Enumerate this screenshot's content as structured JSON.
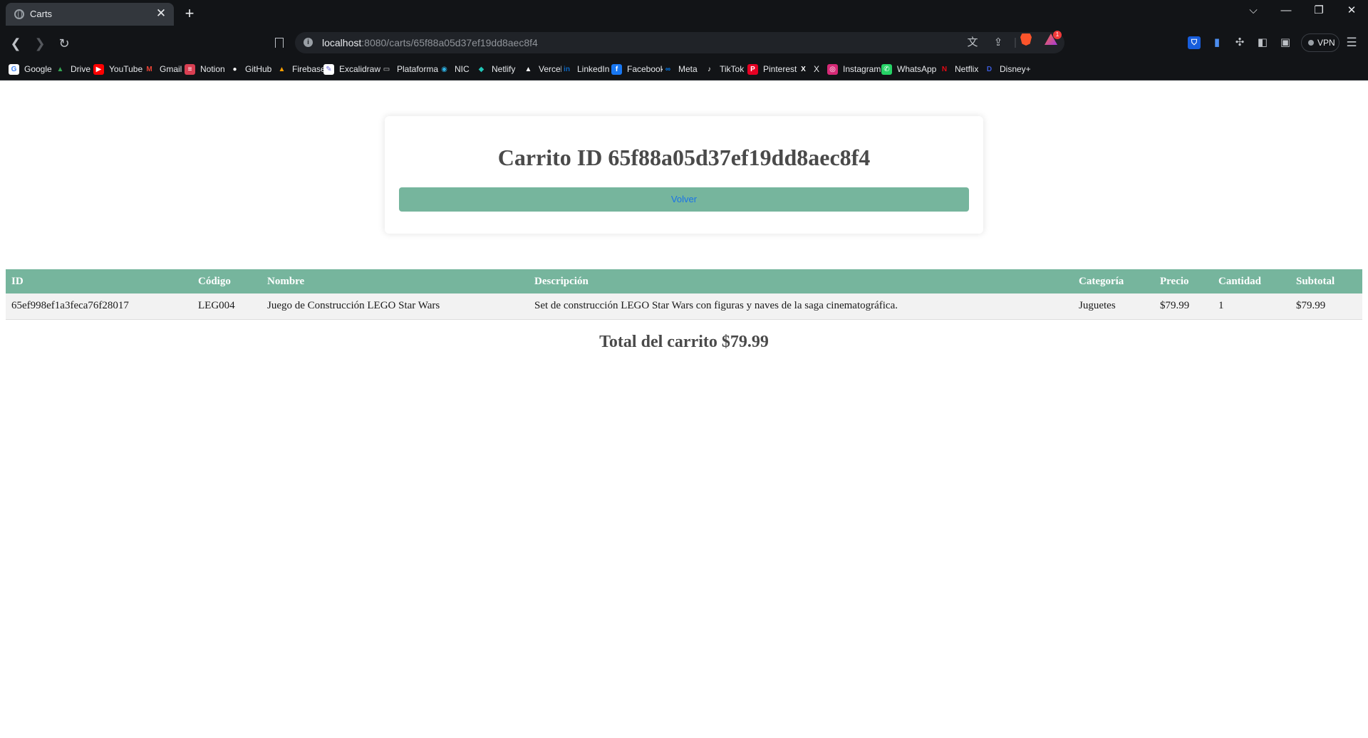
{
  "browser": {
    "tab": {
      "title": "Carts",
      "close": "✕"
    },
    "new_tab": "+",
    "window_controls": {
      "tab_list": "⌵",
      "minimize": "—",
      "restore": "❐",
      "close": "✕"
    },
    "nav": {
      "back": "❮",
      "forward": "❯",
      "reload": "↻"
    },
    "url": {
      "host": "localhost",
      "path": ":8080/carts/65f88a05d37ef19dd8aec8f4"
    },
    "url_icons": {
      "translate": "文",
      "share": "⇪",
      "divider": "|"
    },
    "rewards_count": "1",
    "extensions": {
      "bitwarden": "⛉",
      "extension2": "▮",
      "puzzle": "✣",
      "sidebar": "◧",
      "wallet": "▣"
    },
    "vpn_label": "VPN",
    "menu": "☰"
  },
  "bookmarks": [
    {
      "label": "Google",
      "icon": "google-icon",
      "glyph": "G",
      "color": "#ffffff",
      "fg": "#4285f4"
    },
    {
      "label": "Drive",
      "icon": "drive-icon",
      "glyph": "▲",
      "color": "#121417",
      "fg": "#34a853"
    },
    {
      "label": "YouTube",
      "icon": "youtube-icon",
      "glyph": "▶",
      "color": "#ff0000",
      "fg": "#ffffff"
    },
    {
      "label": "Gmail",
      "icon": "gmail-icon",
      "glyph": "M",
      "color": "#121417",
      "fg": "#ea4335"
    },
    {
      "label": "Notion",
      "icon": "notion-icon",
      "glyph": "≡",
      "color": "#d93f52",
      "fg": "#ffffff"
    },
    {
      "label": "GitHub",
      "icon": "github-icon",
      "glyph": "●",
      "color": "#121417",
      "fg": "#ffffff"
    },
    {
      "label": "Firebase",
      "icon": "firebase-icon",
      "glyph": "▲",
      "color": "#121417",
      "fg": "#ffa000"
    },
    {
      "label": "Excalidraw",
      "icon": "excalidraw-icon",
      "glyph": "✎",
      "color": "#ffffff",
      "fg": "#6965db"
    },
    {
      "label": "Plataforma",
      "icon": "plataforma-icon",
      "glyph": "▭",
      "color": "#121417",
      "fg": "#cccccc"
    },
    {
      "label": "NIC",
      "icon": "nic-icon",
      "glyph": "◉",
      "color": "#121417",
      "fg": "#2eb3e6"
    },
    {
      "label": "Netlify",
      "icon": "netlify-icon",
      "glyph": "◆",
      "color": "#121417",
      "fg": "#20c6b7"
    },
    {
      "label": "Vercel",
      "icon": "vercel-icon",
      "glyph": "▲",
      "color": "#121417",
      "fg": "#ffffff"
    },
    {
      "label": "LinkedIn",
      "icon": "linkedin-icon",
      "glyph": "in",
      "color": "#121417",
      "fg": "#0a66c2"
    },
    {
      "label": "Facebook",
      "icon": "facebook-icon",
      "glyph": "f",
      "color": "#1877f2",
      "fg": "#ffffff"
    },
    {
      "label": "Meta",
      "icon": "meta-icon",
      "glyph": "∞",
      "color": "#121417",
      "fg": "#0081fb"
    },
    {
      "label": "TikTok",
      "icon": "tiktok-icon",
      "glyph": "♪",
      "color": "#121417",
      "fg": "#ffffff"
    },
    {
      "label": "Pinterest",
      "icon": "pinterest-icon",
      "glyph": "P",
      "color": "#e60023",
      "fg": "#ffffff"
    },
    {
      "label": "X",
      "icon": "x-icon",
      "glyph": "X",
      "color": "#121417",
      "fg": "#ffffff"
    },
    {
      "label": "Instagram",
      "icon": "instagram-icon",
      "glyph": "◎",
      "color": "#d62976",
      "fg": "#ffffff"
    },
    {
      "label": "WhatsApp",
      "icon": "whatsapp-icon",
      "glyph": "✆",
      "color": "#25d366",
      "fg": "#ffffff"
    },
    {
      "label": "Netflix",
      "icon": "netflix-icon",
      "glyph": "N",
      "color": "#121417",
      "fg": "#e50914"
    },
    {
      "label": "Disney+",
      "icon": "disney-icon",
      "glyph": "D",
      "color": "#121417",
      "fg": "#3b5bdb"
    }
  ],
  "page": {
    "title": "Carrito ID 65f88a05d37ef19dd8aec8f4",
    "back_button": "Volver",
    "table": {
      "headers": [
        "ID",
        "Código",
        "Nombre",
        "Descripción",
        "Categoría",
        "Precio",
        "Cantidad",
        "Subtotal"
      ],
      "rows": [
        [
          "65ef998ef1a3feca76f28017",
          "LEG004",
          "Juego de Construcción LEGO Star Wars",
          "Set de construcción LEGO Star Wars con figuras y naves de la saga cinematográfica.",
          "Juguetes",
          "$79.99",
          "1",
          "$79.99"
        ]
      ]
    },
    "total": "Total del carrito $79.99"
  },
  "colors": {
    "accent_green": "#76b59d",
    "link_blue": "#1a73e8",
    "browser_chrome": "#121417"
  }
}
